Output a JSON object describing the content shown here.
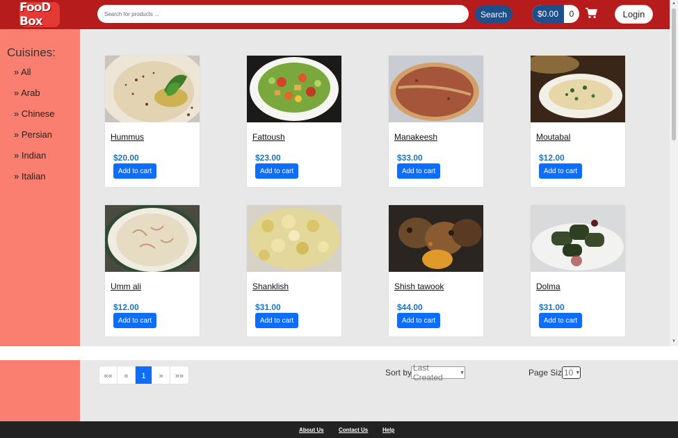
{
  "header": {
    "logo_text": "FooD Box",
    "search_placeholder": "Search for products ...",
    "search_label": "Search",
    "cart_total": "$0.00",
    "cart_count": "0",
    "login_label": "Login"
  },
  "sidebar": {
    "title": "Cuisines:",
    "items": [
      "» All",
      "» Arab",
      "» Chinese",
      "» Persian",
      "» Indian",
      "» Italian"
    ]
  },
  "products": [
    {
      "name": "Hummus",
      "price": "$20.00",
      "button": "Add to cart"
    },
    {
      "name": "Fattoush",
      "price": "$23.00",
      "button": "Add to cart"
    },
    {
      "name": "Manakeesh",
      "price": "$33.00",
      "button": "Add to cart"
    },
    {
      "name": "Moutabal",
      "price": "$12.00",
      "button": "Add to cart"
    },
    {
      "name": "Umm ali",
      "price": "$12.00",
      "button": "Add to cart"
    },
    {
      "name": "Shanklish",
      "price": "$31.00",
      "button": "Add to cart"
    },
    {
      "name": "Shish tawook",
      "price": "$44.00",
      "button": "Add to cart"
    },
    {
      "name": "Dolma",
      "price": "$31.00",
      "button": "Add to cart"
    }
  ],
  "pagination": {
    "first": "««",
    "prev": "«",
    "current": "1",
    "next": "»",
    "last": "»»"
  },
  "sort": {
    "label": "Sort by",
    "selected": "Last Created"
  },
  "page_size": {
    "label": "Page Size",
    "selected": "10"
  },
  "footer": {
    "about": "About Us",
    "contact": "Contact Us",
    "help": "Help"
  },
  "colors": {
    "header": "#b71c1c",
    "sidebar": "#fa7f70",
    "accent": "#0d6efd",
    "price": "#1e73be"
  }
}
